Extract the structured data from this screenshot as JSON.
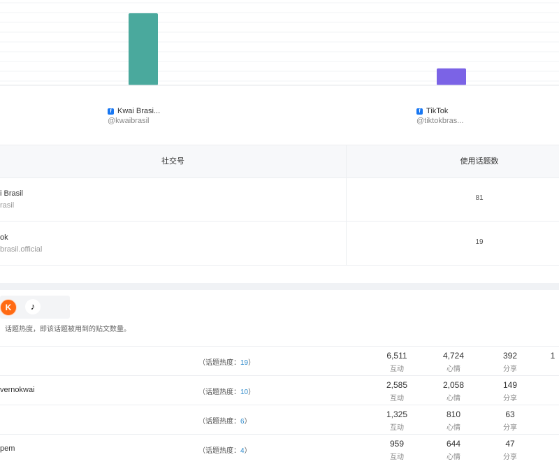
{
  "chart_data": {
    "type": "bar",
    "categories": [
      "Kwai Brasi...",
      "TikTok"
    ],
    "handles": [
      "@kwaibrasil",
      "@tiktokbras..."
    ],
    "values": [
      81,
      19
    ],
    "colors": [
      "#4aa99d",
      "#7b63e6"
    ],
    "grid": true
  },
  "table": {
    "headers": [
      "社交号",
      "使用话题数"
    ],
    "rows": [
      {
        "name": "i Brasil",
        "handle": "rasil",
        "count": "81"
      },
      {
        "name": "ok",
        "handle": "brasil.official",
        "count": "19"
      }
    ]
  },
  "platforms": {
    "kwai_icon": "kwai-icon",
    "tiktok_icon": "tiktok-icon",
    "hint": "话题热度，即该话题被用到的贴文数量。"
  },
  "topics": {
    "heat_prefix": "（话题热度：",
    "heat_suffix": "）",
    "rows": [
      {
        "name": "",
        "heat": "19",
        "m1": "6,511",
        "m2": "4,724",
        "m3": "392",
        "m4": "1"
      },
      {
        "name": "vernokwai",
        "heat": "10",
        "m1": "2,585",
        "m2": "2,058",
        "m3": "149",
        "m4": ""
      },
      {
        "name": "",
        "heat": "6",
        "m1": "1,325",
        "m2": "810",
        "m3": "63",
        "m4": ""
      },
      {
        "name": "pem",
        "heat": "4",
        "m1": "959",
        "m2": "644",
        "m3": "47",
        "m4": ""
      }
    ],
    "labels": {
      "m1": "互动",
      "m2": "心情",
      "m3": "分享"
    }
  }
}
